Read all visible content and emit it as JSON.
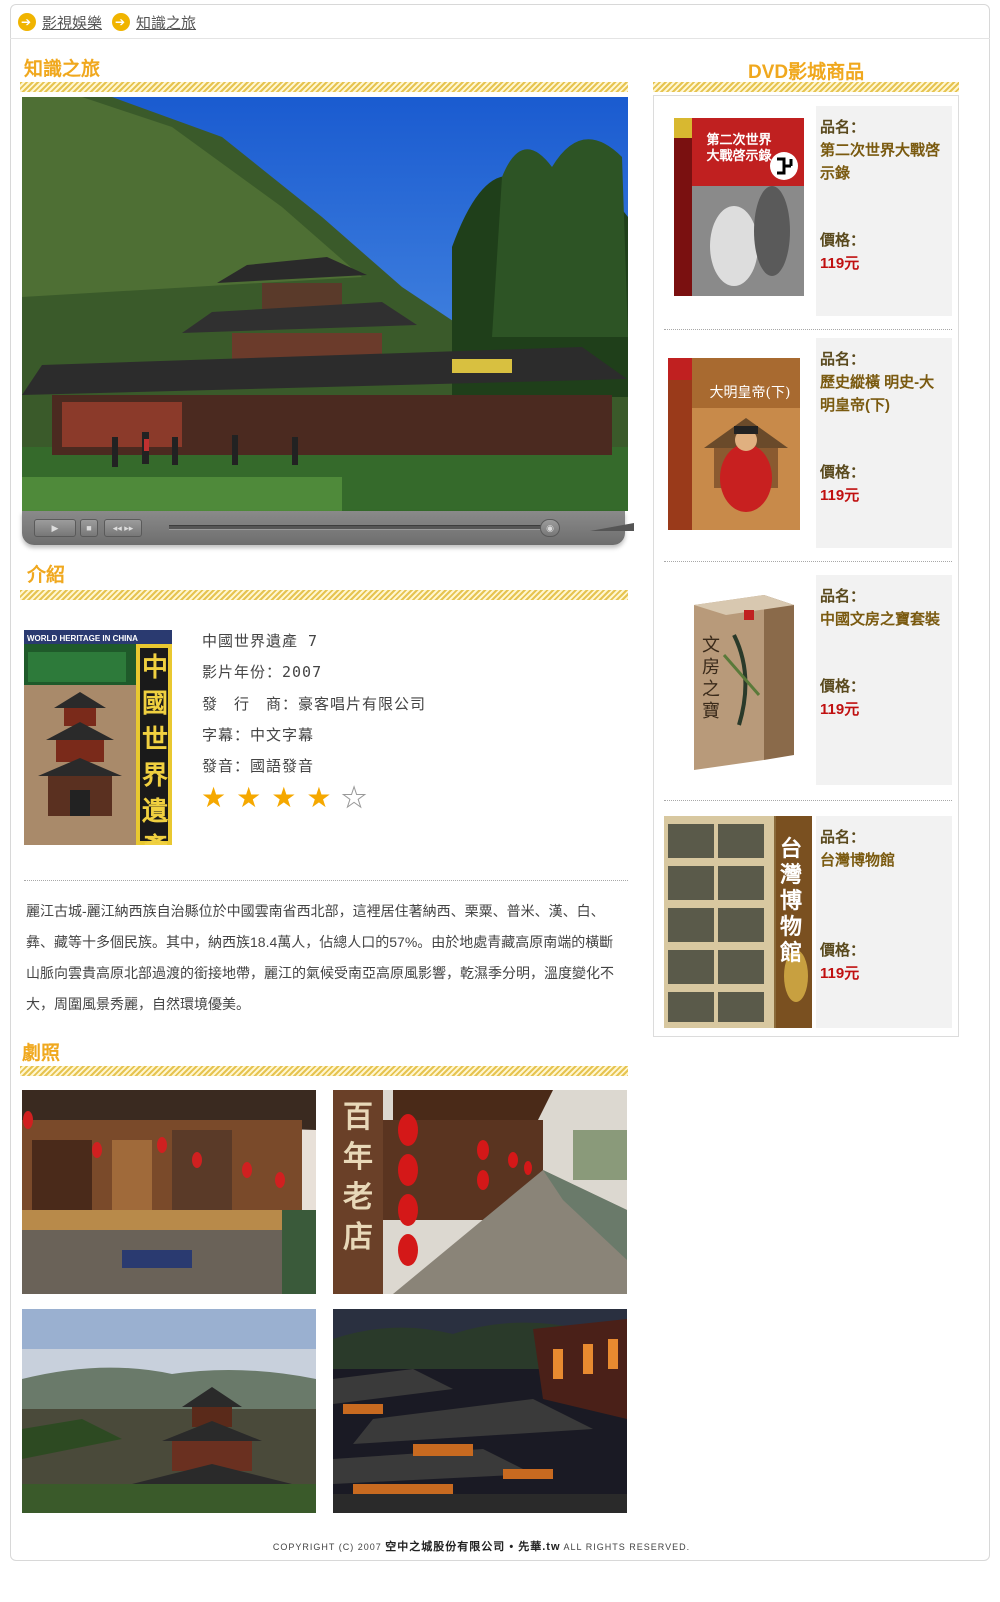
{
  "breadcrumb": [
    "影視娛樂",
    "知識之旅"
  ],
  "sections": {
    "main_title": "知識之旅",
    "intro_title": "介紹",
    "gallery_title": "劇照",
    "dvd_title": "DVD影城商品"
  },
  "movie": {
    "title": "中國世界遺產 7",
    "year": "影片年份：2007",
    "publisher": "發　行　商：豪客唱片有限公司",
    "subtitle": "字幕：中文字幕",
    "audio": "發音：國語發音",
    "rating": 4,
    "rating_max": 5,
    "cover_text": "中國世界遺產",
    "cover_banner": "WORLD HERITAGE IN CHINA",
    "description": "麗江古城-麗江納西族自治縣位於中國雲南省西北部，這裡居住著納西、栗粟、普米、漢、白、彝、藏等十多個民族。其中，納西族18.4萬人，佔總人口的57%。由於地處青藏高原南端的橫斷山脈向雲貴高原北部過渡的銜接地帶，麗江的氣候受南亞高原風影響，乾濕季分明，溫度變化不大，周圍風景秀麗，自然環境優美。"
  },
  "dvd_items": [
    {
      "name_label": "品名：",
      "name": "第二次世界大戰啓示錄",
      "price_label": "價格：",
      "price": "119元",
      "cover_text": "第二次世界大戰啓示錄"
    },
    {
      "name_label": "品名：",
      "name": "歷史縱橫 明史-大明皇帝(下)",
      "price_label": "價格：",
      "price": "119元",
      "cover_text": "大明皇帝(下)"
    },
    {
      "name_label": "品名：",
      "name": "中國文房之寶套裝",
      "price_label": "價格：",
      "price": "119元",
      "cover_text": "文房之寶"
    },
    {
      "name_label": "品名：",
      "name": "台灣博物館",
      "price_label": "價格：",
      "price": "119元",
      "cover_text": "台灣博物館"
    }
  ],
  "gallery_captions": [
    "百年老店"
  ],
  "footer": {
    "prefix": "COPYRIGHT (C) 2007",
    "company": "空中之城股份有限公司 • 先華.tw",
    "suffix": "ALL RIGHTS RESERVED."
  },
  "colors": {
    "accent": "#f0a81e",
    "price": "#c01010",
    "stripe": "#e6c451"
  }
}
